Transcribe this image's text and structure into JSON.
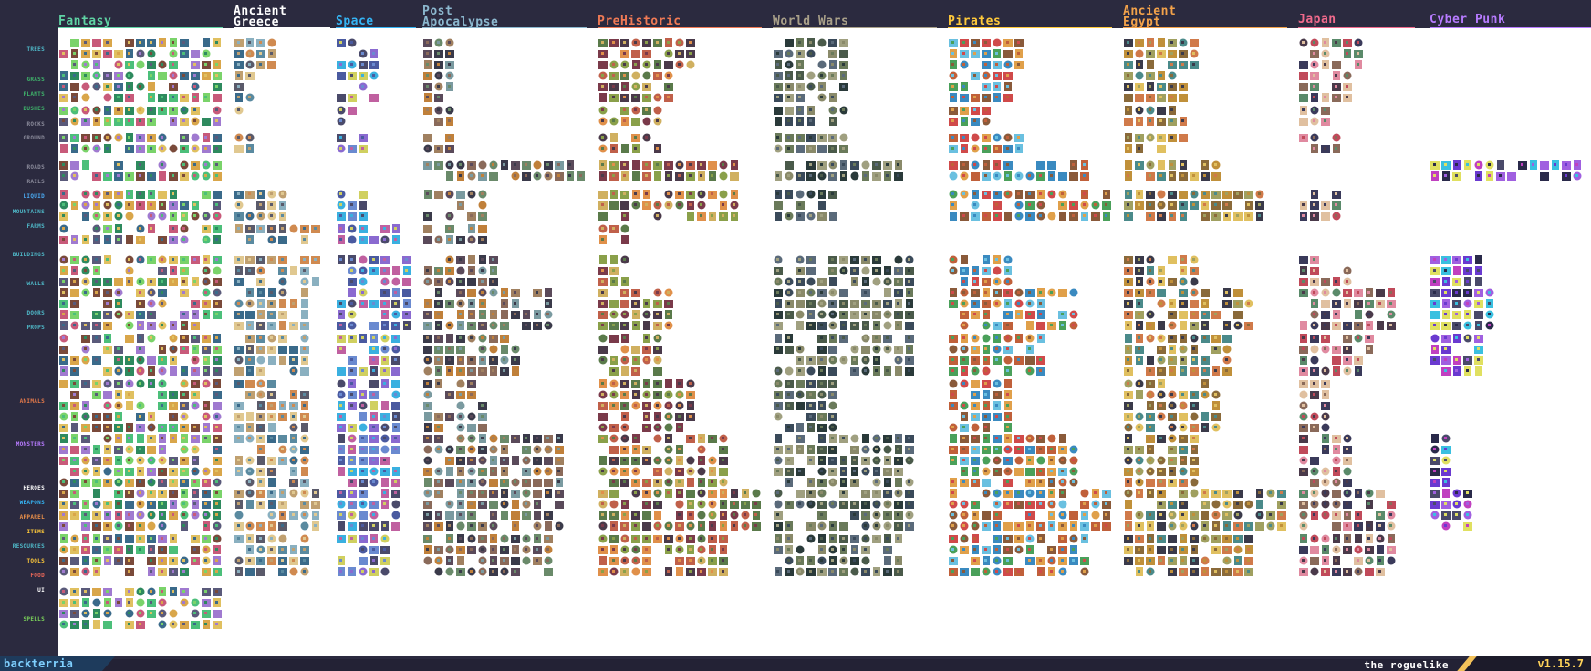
{
  "themes": [
    {
      "id": "fantasy",
      "title": "Fantasy",
      "color": "#5fd3a4"
    },
    {
      "id": "ancient-greece",
      "title": "Ancient\nGreece",
      "color": "#ffffff"
    },
    {
      "id": "space",
      "title": "Space",
      "color": "#35b4f4"
    },
    {
      "id": "post-apocalypse",
      "title": "Post\nApocalypse",
      "color": "#8cb8cf"
    },
    {
      "id": "prehistoric",
      "title": "PreHistoric",
      "color": "#f07a55"
    },
    {
      "id": "world-wars",
      "title": "World Wars",
      "color": "#a9a089"
    },
    {
      "id": "pirates",
      "title": "Pirates",
      "color": "#ffc93a"
    },
    {
      "id": "ancient-egypt",
      "title": "Ancient\nEgypt",
      "color": "#f3a24a"
    },
    {
      "id": "japan",
      "title": "Japan",
      "color": "#f06a8c"
    },
    {
      "id": "cyber-punk",
      "title": "Cyber Punk",
      "color": "#b77bff"
    }
  ],
  "categories": [
    {
      "label": "TREES",
      "color": "#4fb8c8"
    },
    {
      "label": "GRASS",
      "color": "#3fb46b"
    },
    {
      "label": "PLANTS",
      "color": "#3fb46b"
    },
    {
      "label": "BUSHES",
      "color": "#3fb46b"
    },
    {
      "label": "ROCKS",
      "color": "#8a8a9a"
    },
    {
      "label": "GROUND",
      "color": "#8a8a9a"
    },
    {
      "label": "ROADS",
      "color": "#8a8a9a"
    },
    {
      "label": "RAILS",
      "color": "#8a8a9a"
    },
    {
      "label": "LIQUID",
      "color": "#4aa8f0"
    },
    {
      "label": "MOUNTAINS",
      "color": "#4fb8c8"
    },
    {
      "label": "FARMS",
      "color": "#4fb8c8"
    },
    {
      "label": "BUILDINGS",
      "color": "#4fb8c8"
    },
    {
      "label": "WALLS",
      "color": "#4fb8c8"
    },
    {
      "label": "DOORS",
      "color": "#4fb8c8"
    },
    {
      "label": "PROPS",
      "color": "#4fb8c8"
    },
    {
      "label": "ANIMALS",
      "color": "#e67a4a"
    },
    {
      "label": "MONSTERS",
      "color": "#b77bff"
    },
    {
      "label": "HEROES",
      "color": "#ffffff"
    },
    {
      "label": "WEAPONS",
      "color": "#35b4f4"
    },
    {
      "label": "APPAREL",
      "color": "#f0934a"
    },
    {
      "label": "ITEMS",
      "color": "#ffc93a"
    },
    {
      "label": "RESOURCES",
      "color": "#4fb8c8"
    },
    {
      "label": "TOOLS",
      "color": "#ffc93a"
    },
    {
      "label": "FOOD",
      "color": "#f06a5a"
    },
    {
      "label": "UI",
      "color": "#ffffff"
    },
    {
      "label": "SPELLS",
      "color": "#7bd35a"
    }
  ],
  "footer": {
    "brand": "backterria",
    "tagline": "the roguelike",
    "version": "v1.15.7"
  },
  "colors": {
    "background": "#2b2a3f",
    "sheet": "#ffffff"
  }
}
